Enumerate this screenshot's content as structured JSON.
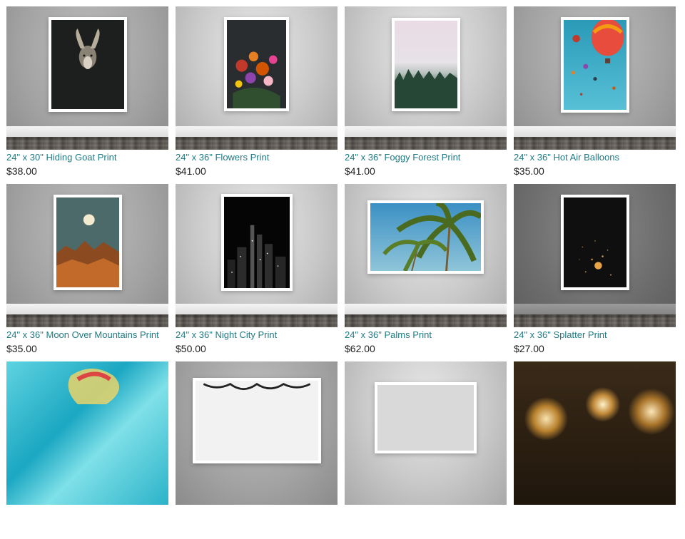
{
  "products": [
    {
      "title": "24\" x 30\" Hiding Goat Print",
      "price": "$38.00"
    },
    {
      "title": "24\" x 36\" Flowers Print",
      "price": "$41.00"
    },
    {
      "title": "24\" x 36\" Foggy Forest Print",
      "price": "$41.00"
    },
    {
      "title": "24\" x 36\" Hot Air Balloons",
      "price": "$35.00"
    },
    {
      "title": "24\" x 36\" Moon Over Mountains Print",
      "price": "$35.00"
    },
    {
      "title": "24\" x 36\" Night City Print",
      "price": "$50.00"
    },
    {
      "title": "24\" x 36\" Palms Print",
      "price": "$62.00"
    },
    {
      "title": "24\" x 36\" Splatter Print",
      "price": "$27.00"
    }
  ]
}
